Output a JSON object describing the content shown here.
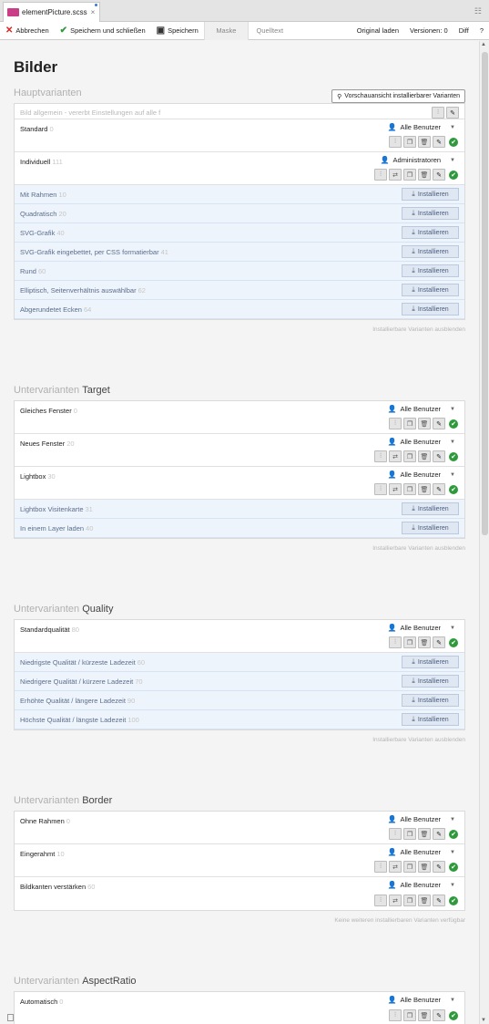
{
  "tab": {
    "title": "elementPicture.scss",
    "close": "×"
  },
  "toolbar": {
    "cancel": "Abbrechen",
    "save_close": "Speichern und schließen",
    "save": "Speichern",
    "tab_mask": "Maske",
    "tab_source": "Quelltext",
    "load_original": "Original laden",
    "versions": "Versionen: 0",
    "diff": "Diff",
    "help": "?"
  },
  "page": {
    "title": "Bilder",
    "preview_button": "Vorschauansicht installierbarer Varianten"
  },
  "icons": {
    "user": "person-icon",
    "ok": "check-icon"
  },
  "colors": {
    "accent": "#2e9a3c",
    "install_bg": "#eef4fc",
    "admin": "#cc4444"
  },
  "sections": [
    {
      "prefix": "Hauptvarianten",
      "name": "",
      "general": "Bild allgemein - vererbt Einstellungen auf alle f",
      "variants": [
        {
          "label": "Standard",
          "num": "0",
          "user": "Alle Benutzer",
          "admin": false,
          "extra": false
        },
        {
          "label": "Individuell",
          "num": "111",
          "user": "Administratoren",
          "admin": true,
          "extra": true
        }
      ],
      "installs": [
        {
          "label": "Mit Rahmen",
          "num": "10"
        },
        {
          "label": "Quadratisch",
          "num": "20"
        },
        {
          "label": "SVG-Grafik",
          "num": "40"
        },
        {
          "label": "SVG-Grafik eingebettet, per CSS formatierbar",
          "num": "41"
        },
        {
          "label": "Rund",
          "num": "60"
        },
        {
          "label": "Elliptisch, Seitenverhältnis auswählbar",
          "num": "62"
        },
        {
          "label": "Abgerundetet Ecken",
          "num": "64"
        }
      ],
      "hint": "Installierbare Varianten ausblenden"
    },
    {
      "prefix": "Untervarianten",
      "name": "Target",
      "variants": [
        {
          "label": "Gleiches Fenster",
          "num": "0",
          "user": "Alle Benutzer",
          "admin": false,
          "extra": false
        },
        {
          "label": "Neues Fenster",
          "num": "20",
          "user": "Alle Benutzer",
          "admin": false,
          "extra": true
        },
        {
          "label": "Lightbox",
          "num": "30",
          "user": "Alle Benutzer",
          "admin": false,
          "extra": true
        }
      ],
      "installs": [
        {
          "label": "Lightbox Visitenkarte",
          "num": "31"
        },
        {
          "label": "In einem Layer laden",
          "num": "40"
        }
      ],
      "hint": "Installierbare Varianten ausblenden"
    },
    {
      "prefix": "Untervarianten",
      "name": "Quality",
      "variants": [
        {
          "label": "Standardqualität",
          "num": "80",
          "user": "Alle Benutzer",
          "admin": false,
          "extra": false
        }
      ],
      "installs": [
        {
          "label": "Niedrigste Qualität / kürzeste Ladezeit",
          "num": "60"
        },
        {
          "label": "Niedrigere Qualität / kürzere Ladezeit",
          "num": "70"
        },
        {
          "label": "Erhöhte Qualität / längere Ladezeit",
          "num": "90"
        },
        {
          "label": "Höchste Qualität / längste Ladezeit",
          "num": "100"
        }
      ],
      "hint": "Installierbare Varianten ausblenden"
    },
    {
      "prefix": "Untervarianten",
      "name": "Border",
      "variants": [
        {
          "label": "Ohne Rahmen",
          "num": "0",
          "user": "Alle Benutzer",
          "admin": false,
          "extra": false
        },
        {
          "label": "Eingerahmt",
          "num": "10",
          "user": "Alle Benutzer",
          "admin": false,
          "extra": true
        },
        {
          "label": "Bildkanten verstärken",
          "num": "60",
          "user": "Alle Benutzer",
          "admin": false,
          "extra": true
        }
      ],
      "installs": [],
      "hint": "Keine weiteren installierbaren Varianten verfügbar"
    },
    {
      "prefix": "Untervarianten",
      "name": "AspectRatio",
      "variants": [
        {
          "label": "Automatisch",
          "num": "0",
          "user": "Alle Benutzer",
          "admin": false,
          "extra": false
        }
      ],
      "installs": [],
      "hint": ""
    }
  ],
  "install_label": "Installieren"
}
